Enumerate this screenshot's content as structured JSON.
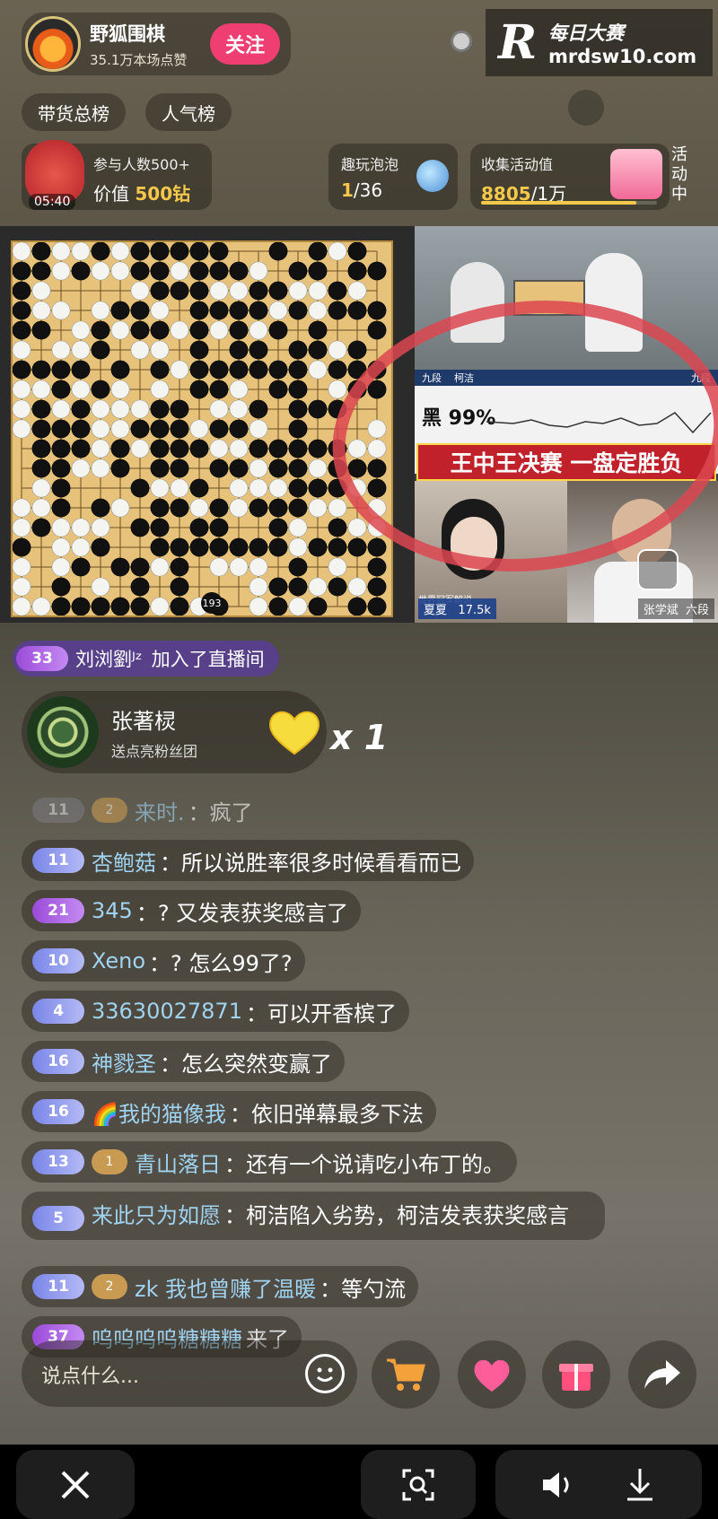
{
  "header": {
    "host_name": "野狐围棋",
    "host_likes": "35.1万本场点赞",
    "follow_label": "关注",
    "watermark_logo": "R",
    "watermark_title": "每日大赛",
    "watermark_url": "mrdsw10.com"
  },
  "rank_tabs": [
    {
      "label": "带货总榜"
    },
    {
      "label": "人气榜"
    }
  ],
  "cards": {
    "lucky_bag": {
      "timer": "05:40",
      "line1": "参与人数500+",
      "value_prefix": "价值",
      "value": "500钻"
    },
    "bubble": {
      "title": "趣玩泡泡",
      "current": "1",
      "total": "/36"
    },
    "collect": {
      "title": "收集活动值",
      "current": "8805",
      "target": "/1万",
      "progress": 0.8805
    },
    "activity_label": "活动中"
  },
  "video": {
    "move_number": "193",
    "eval_text": "黑 99%",
    "headline": "王中王决赛 一盘定胜负",
    "player_left_tag": "九段",
    "player_left_name": "柯洁",
    "player_right_tag": "九段",
    "commentator_left": "夏夏",
    "commentator_left_views": "17.5k",
    "commentator_left_bg": "世界冠军解说",
    "commentator_right": "张学斌",
    "commentator_right_rank": "六段"
  },
  "join_notice": {
    "level": "33",
    "user": "刘浏劉ᴶᶻ",
    "action": "加入了直播间"
  },
  "gift": {
    "user": "张著棂",
    "sub": "送点亮粉丝团",
    "count": "x 1"
  },
  "chat": [
    {
      "level": "11",
      "fan": "2",
      "user": "来时.",
      "msg": "疯了",
      "faded": true
    },
    {
      "level": "11",
      "fan": "",
      "user": "杏鲍菇",
      "msg": "所以说胜率很多时候看看而已"
    },
    {
      "level": "21",
      "fan": "",
      "user": "345",
      "msg": "? 又发表获奖感言了",
      "purple": true
    },
    {
      "level": "10",
      "fan": "",
      "user": "Xeno",
      "msg": "? 怎么99了?"
    },
    {
      "level": "4",
      "fan": "",
      "user": "33630027871",
      "msg": "可以开香槟了"
    },
    {
      "level": "16",
      "fan": "",
      "user": "神戮圣",
      "msg": "怎么突然变赢了"
    },
    {
      "level": "16",
      "fan": "",
      "user": "🌈我的猫像我",
      "msg": "依旧弹幕最多下法"
    },
    {
      "level": "13",
      "fan": "1",
      "user": "青山落日",
      "msg": "还有一个说请吃小布丁的。"
    },
    {
      "level": "5",
      "fan": "",
      "user": "来此只为如愿",
      "msg": "柯洁陷入劣势，柯洁发表获奖感言",
      "wrap": true
    },
    {
      "level": "11",
      "fan": "2",
      "user": "zk 我也曾赚了温暖",
      "msg": "等勺流"
    },
    {
      "level": "37",
      "fan": "",
      "user": "呜呜呜呜糖糖糖",
      "msg": "来了",
      "purple": true,
      "plain": true
    }
  ],
  "input": {
    "placeholder": "说点什么..."
  },
  "colors": {
    "follow": "#ef3e71",
    "gold": "#f5c84a",
    "username": "#9fd3f0",
    "headline_bg": "#c0212b"
  }
}
